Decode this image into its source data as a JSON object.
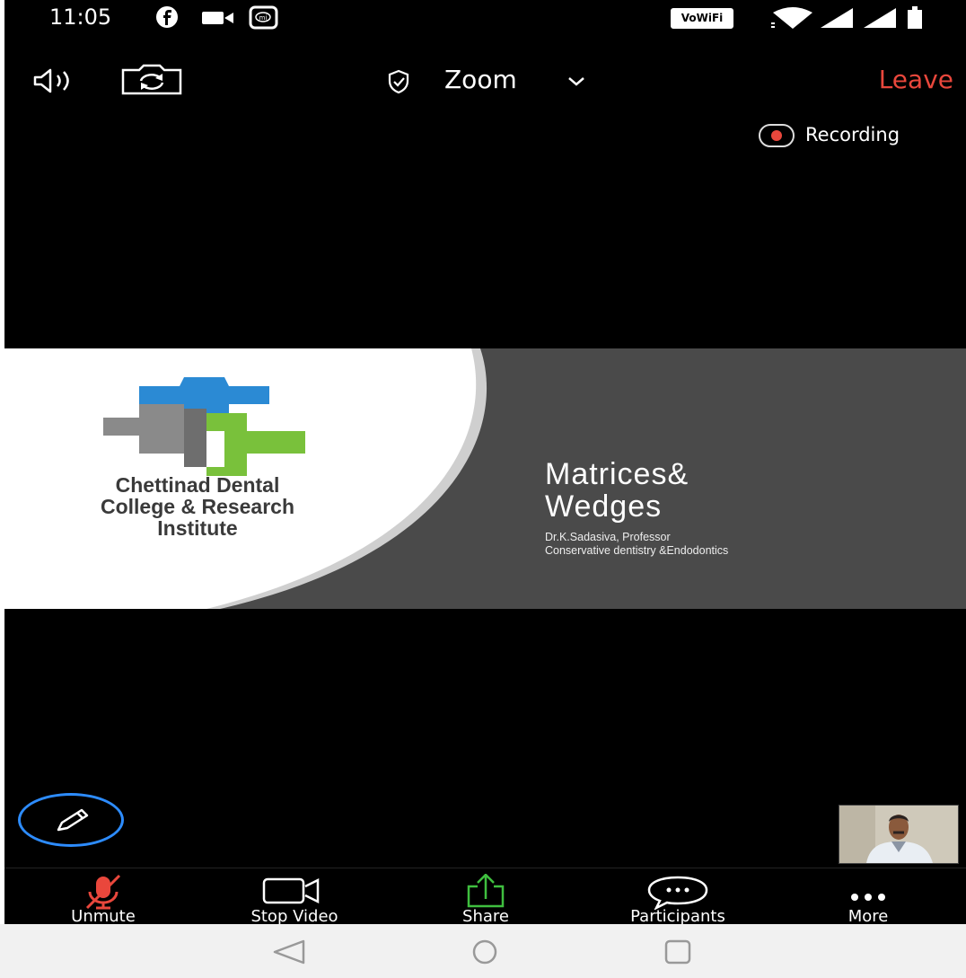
{
  "status_bar": {
    "time": "11:05",
    "wifi_label": "VoWiFi",
    "icons": [
      "facebook-icon",
      "video-camera-icon",
      "mi-icon",
      "wifi-icon",
      "signal-icon",
      "signal-icon",
      "battery-icon"
    ]
  },
  "top_bar": {
    "title": "Zoom",
    "leave_label": "Leave",
    "icons": [
      "speaker-icon",
      "switch-camera-icon",
      "shield-icon",
      "chevron-down-icon"
    ]
  },
  "recording": {
    "label": "Recording"
  },
  "slide": {
    "college_name_lines": [
      "Chettinad Dental",
      "College & Research",
      "Institute"
    ],
    "title_lines": [
      "Matrices&",
      "Wedges"
    ],
    "presenter": "Dr.K.Sadasiva, Professor",
    "department": "Conservative dentistry &Endodontics"
  },
  "toolbar": {
    "items": [
      {
        "label": "Unmute",
        "icon": "microphone-muted-icon"
      },
      {
        "label": "Stop Video",
        "icon": "video-camera-icon"
      },
      {
        "label": "Share",
        "icon": "share-icon"
      },
      {
        "label": "Participants",
        "icon": "chat-icon"
      },
      {
        "label": "More",
        "icon": "more-icon"
      }
    ]
  },
  "colors": {
    "leave": "#e9473c",
    "share": "#3fbf3f",
    "annotate_ring": "#2d8cff",
    "recording_dot": "#e9473c"
  }
}
